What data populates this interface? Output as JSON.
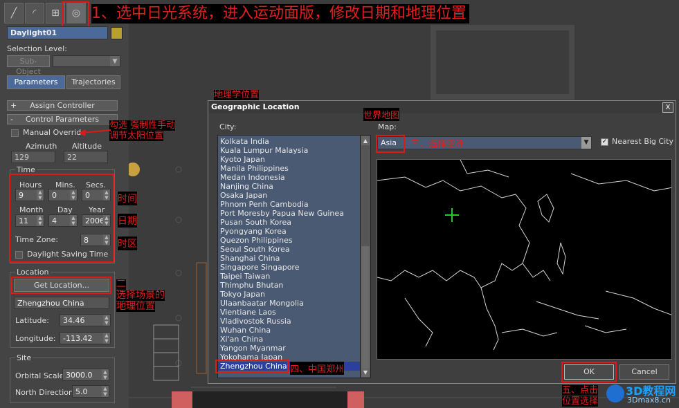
{
  "panel": {
    "tab_icons": [
      "create-icon",
      "modify-icon",
      "hierarchy-icon",
      "motion-icon"
    ],
    "object_name": "Daylight01",
    "object_color": "#b8a030",
    "selection_level_label": "Selection Level:",
    "sub_object_label": "Sub-Object",
    "parameters_tab": "Parameters",
    "trajectories_tab": "Trajectories",
    "assign_controller": "Assign Controller",
    "assign_prefix": "+",
    "control_parameters": "Control Parameters",
    "control_prefix": "-",
    "manual_override": "Manual Override",
    "azimuth_label": "Azimuth",
    "altitude_label": "Altitude",
    "azimuth_value": "129",
    "altitude_value": "22",
    "time_group": "Time",
    "hours_label": "Hours",
    "mins_label": "Mins.",
    "secs_label": "Secs.",
    "hours_value": "9",
    "mins_value": "0",
    "secs_value": "0",
    "month_label": "Month",
    "day_label": "Day",
    "year_label": "Year",
    "month_value": "11",
    "day_value": "4",
    "year_value": "2006",
    "timezone_label": "Time Zone:",
    "timezone_value": "8",
    "dst_label": "Daylight Saving Time",
    "location_group": "Location",
    "get_location": "Get Location...",
    "location_name": "Zhengzhou China",
    "latitude_label": "Latitude:",
    "latitude_value": "34.46",
    "longitude_label": "Longitude:",
    "longitude_value": "-113.42",
    "site_group": "Site",
    "orbital_label": "Orbital Scale:",
    "orbital_value": "3000.0",
    "north_label": "North Direction:",
    "north_value": "5.0"
  },
  "annotations": {
    "step1": "1、选中日光系统，进入运动面版，修改日期和地理位置",
    "manual_tip_1": "勾选 强制性手动",
    "manual_tip_2": "调节太阳位置",
    "time_tip": "时间",
    "date_tip": "日期",
    "zone_tip": "时区",
    "step2_1": "二",
    "step2_2": "选择场景的",
    "step2_3": "地理位置",
    "geo_tip": "地理学位置",
    "map_tip": "世界地图",
    "step3": "三、选择亚洲",
    "step4": "四、中国郑州",
    "step5_1": "五、点击",
    "step5_2": "位置选择"
  },
  "dialog": {
    "title": "Geographic Location",
    "close": "X",
    "city_label": "City:",
    "map_label": "Map:",
    "map_value": "Asia",
    "nearest_label": "Nearest Big City",
    "ok": "OK",
    "cancel": "Cancel",
    "cities": [
      "Kolkata India",
      "Kuala Lumpur Malaysia",
      "Kyoto Japan",
      "Manila Philippines",
      "Medan Indonesia",
      "Nanjing China",
      "Osaka Japan",
      "Phnom Penh Cambodia",
      "Port Moresby Papua New Guinea",
      "Pusan South Korea",
      "Pyongyang Korea",
      "Quezon Philippines",
      "Seoul South Korea",
      "Shanghai China",
      "Singapore Singapore",
      "Taipei Taiwan",
      "Thimphu Bhutan",
      "Tokyo Japan",
      "Ulaanbaatar Mongolia",
      "Vientiane Laos",
      "Vladivostok Russia",
      "Wuhan China",
      "Xi'an China",
      "Yangon Myanmar",
      "Yokohama Japan",
      "Zhengzhou China"
    ],
    "selected_city_index": 25
  },
  "watermark": {
    "brand": "3D教程网",
    "url": "3Dmax8.cn"
  },
  "colors": {
    "annotation_red": "#e01818",
    "panel_bg": "#444444",
    "selection_blue": "#2b3fa0",
    "map_cursor": "#22cc22"
  }
}
